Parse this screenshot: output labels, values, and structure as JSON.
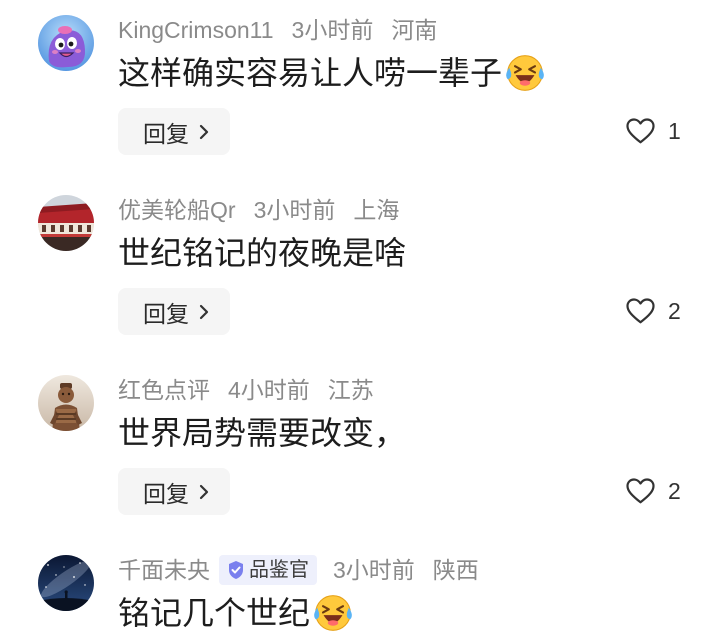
{
  "comments": [
    {
      "avatar_icon": "purple-cartoon-avatar",
      "username": "KingCrimson11",
      "time": "3小时前",
      "location": "河南",
      "text": "这样确实容易让人唠一辈子",
      "emoji_icon": "laughing-crying-emoji-icon",
      "reply_label": "回复",
      "likes": "1"
    },
    {
      "avatar_icon": "palace-roof-avatar",
      "username": "优美轮船Qr",
      "time": "3小时前",
      "location": "上海",
      "text": "世纪铭记的夜晚是啥",
      "reply_label": "回复",
      "likes": "2"
    },
    {
      "avatar_icon": "terracotta-warrior-avatar",
      "username": "红色点评",
      "time": "4小时前",
      "location": "江苏",
      "text": "世界局势需要改变，",
      "reply_label": "回复",
      "likes": "2"
    },
    {
      "avatar_icon": "starry-sky-avatar",
      "username": "千面未央",
      "badge": {
        "label": "品鉴官",
        "icon": "verified-shield-icon"
      },
      "time": "3小时前",
      "location": "陕西",
      "text": "铭记几个世纪",
      "emoji_icon": "laughing-crying-emoji-icon"
    }
  ],
  "icons": {
    "reply_chevron": "chevron-right-icon",
    "like": "heart-outline-icon"
  },
  "colors": {
    "meta_text": "#8a8a8a",
    "comment_text": "#1d1d1d",
    "reply_background": "#f5f5f5",
    "badge_background": "#eef0fc",
    "badge_icon": "#7a80ee",
    "emoji_face": "#ffc93c"
  }
}
